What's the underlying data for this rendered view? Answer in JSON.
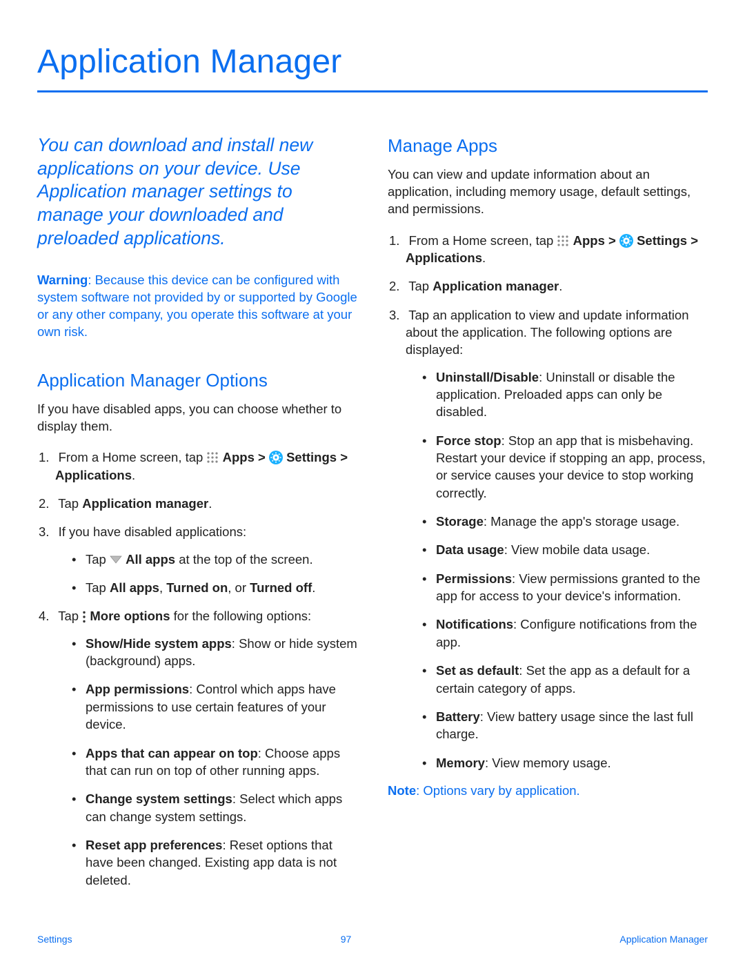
{
  "h1": "Application Manager",
  "intro": "You can download and install new applications on your device. Use Application manager settings to manage your downloaded and preloaded applications.",
  "warning_label": "Warning",
  "warning_text": ": Because this device can be configured with system software not provided by or supported by Google or any other company, you operate this software at your own risk.",
  "sec_options_head": "Application Manager Options",
  "sec_options_para": "If you have disabled apps, you can choose whether to display them.",
  "step1a": "From a Home screen, tap ",
  "apps_label": "Apps",
  "sep_gt": " > ",
  "settings_label": "Settings",
  "applications_label": "Applications",
  "period": ".",
  "step2a": "Tap ",
  "app_manager_label": "Application manager",
  "step3": "If you have disabled applications:",
  "b3_1_tap": "Tap ",
  "all_apps_label": "All apps",
  "b3_1_tail": " at the top of the screen.",
  "b3_2_pre": "Tap ",
  "b3_2_comma": ", ",
  "turned_on": "Turned on",
  "b3_2_or": ", or ",
  "turned_off": "Turned off",
  "step4_tap": "Tap ",
  "more_options_label": "More options",
  "step4_tail": " for the following options:",
  "o4_1_b": "Show/Hide system apps",
  "o4_1_t": ": Show or hide system (background) apps.",
  "o4_2_b": "App permissions",
  "o4_2_t": ": Control which apps have permissions to use certain features of your device.",
  "o4_3_b": "Apps that can appear on top",
  "o4_3_t": ": Choose apps that can run on top of other running apps.",
  "o4_4_b": "Change system settings",
  "o4_4_t": ": Select which apps can change system settings.",
  "o4_5_b": "Reset app preferences",
  "o4_5_t": ": Reset options that have been changed. Existing app data is not deleted.",
  "sec_manage_head": "Manage Apps",
  "manage_para": "You can view and update information about an application, including memory usage, default settings, and permissions.",
  "m3": "Tap an application to view and update information about the application. The following options are displayed:",
  "d1_b": "Uninstall/Disable",
  "d1_t": ": Uninstall or disable the application. Preloaded apps can only be disabled.",
  "d2_b": "Force stop",
  "d2_t": ": Stop an app that is misbehaving. Restart your device if stopping an app, process, or service causes your device to stop working correctly.",
  "d3_b": "Storage",
  "d3_t": ": Manage the app's storage usage.",
  "d4_b": "Data usage",
  "d4_t": ": View mobile data usage.",
  "d5_b": "Permissions",
  "d5_t": ": View permissions granted to the app for access to your device's information.",
  "d6_b": "Notifications",
  "d6_t": ": Configure notifications from the app.",
  "d7_b": "Set as default",
  "d7_t": ": Set the app as a default for a certain category of apps.",
  "d8_b": "Battery",
  "d8_t": ": View battery usage since the last full charge.",
  "d9_b": "Memory",
  "d9_t": ": View memory usage.",
  "note_label": "Note",
  "note_text": ": Options vary by application.",
  "footer_left": "Settings",
  "footer_center": "97",
  "footer_right": "Application Manager"
}
